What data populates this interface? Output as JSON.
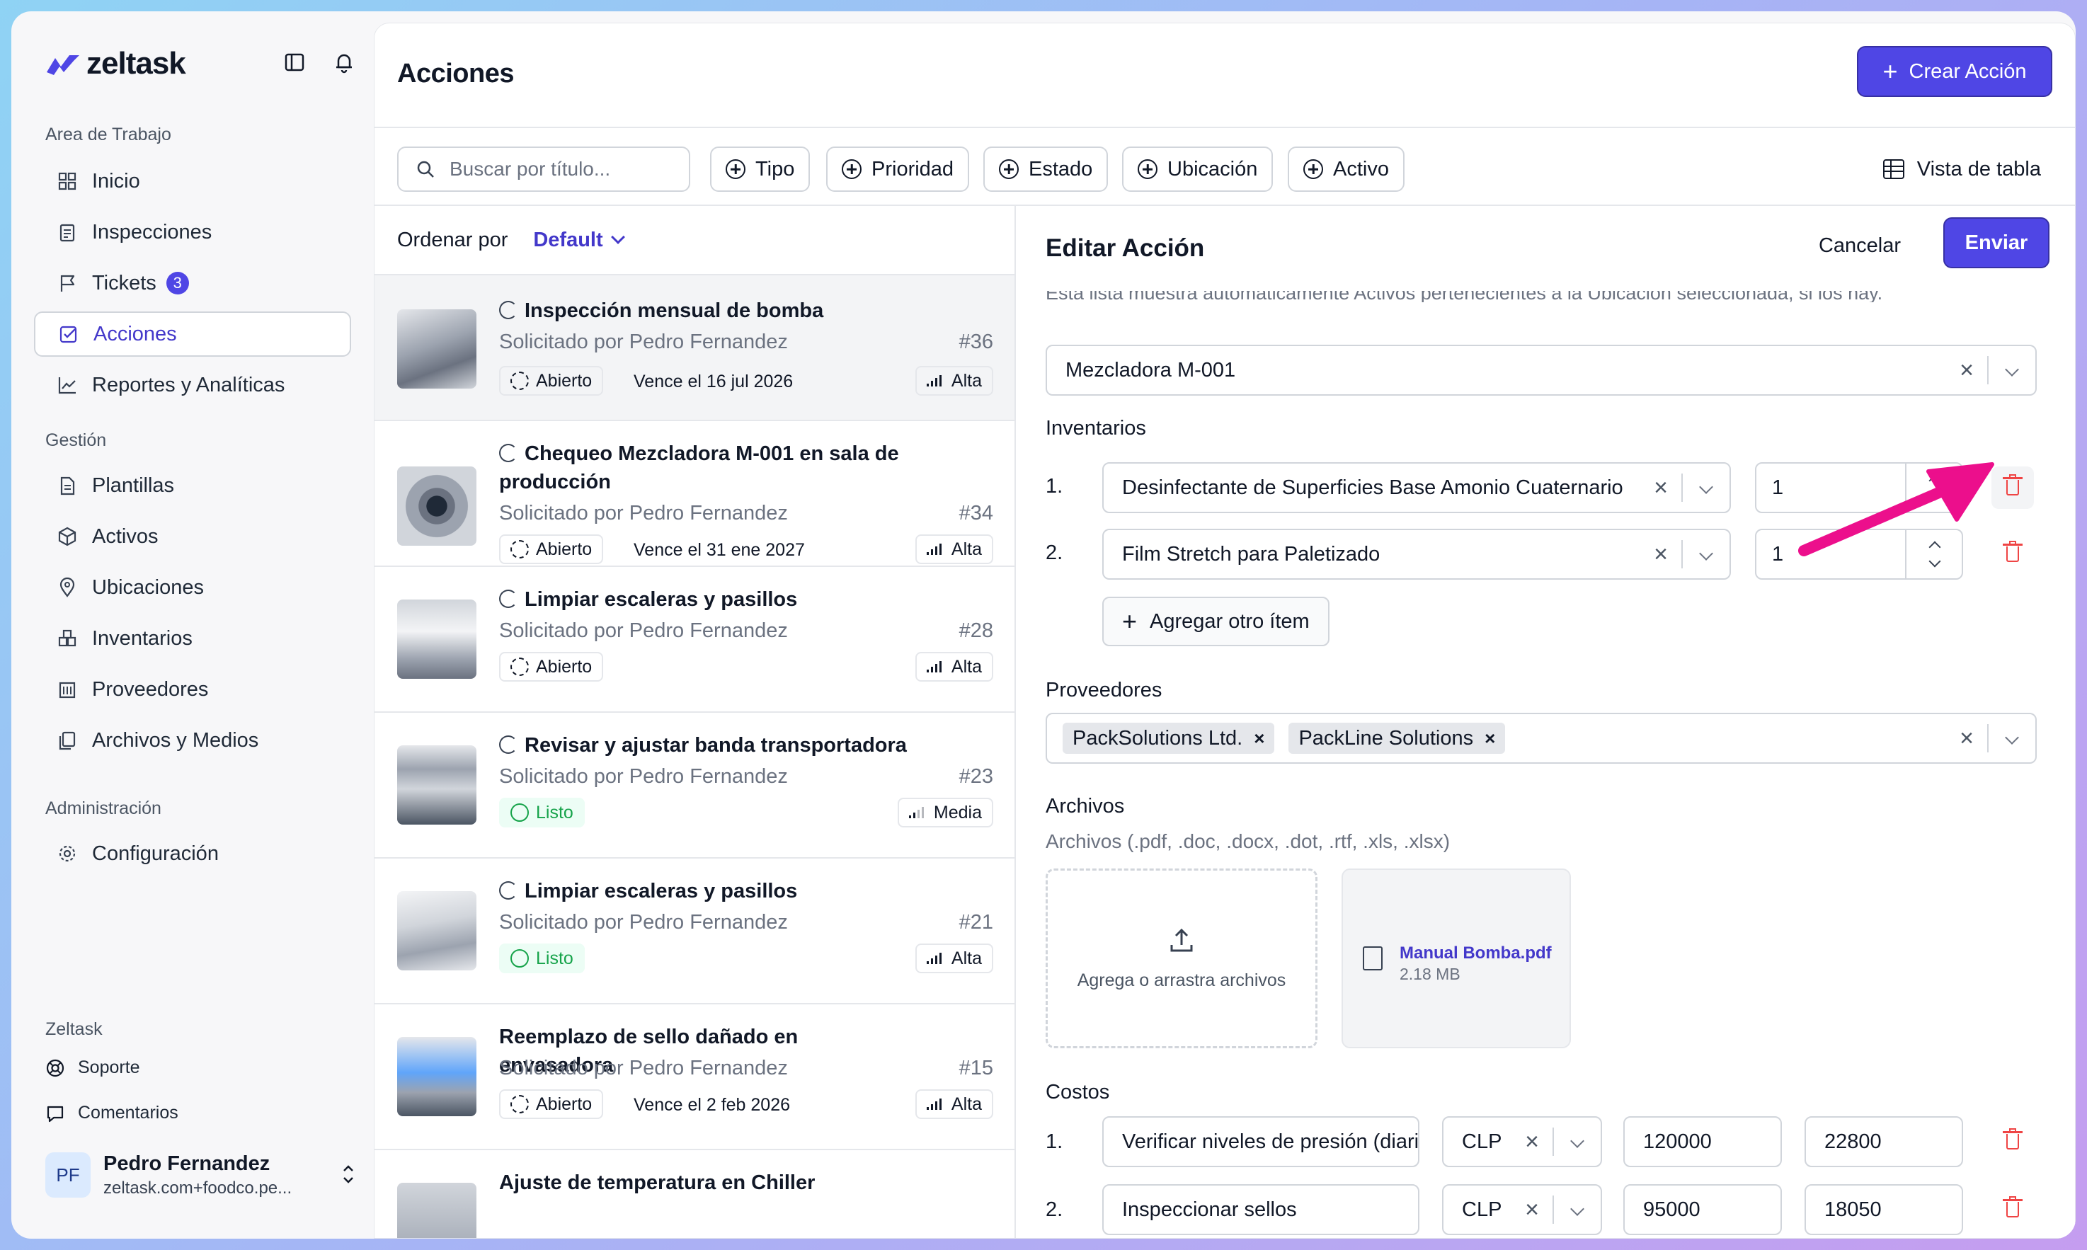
{
  "brand": {
    "name": "zeltask",
    "color": "#4f46e5"
  },
  "sidebar": {
    "workspace_label": "Area de Trabajo",
    "workspace": [
      {
        "label": "Inicio",
        "icon": "grid-icon"
      },
      {
        "label": "Inspecciones",
        "icon": "clipboard-icon"
      },
      {
        "label": "Tickets",
        "icon": "flag-icon",
        "badge": "3"
      },
      {
        "label": "Acciones",
        "icon": "check-square-icon",
        "active": true
      },
      {
        "label": "Reportes y Analíticas",
        "icon": "chart-line-icon"
      }
    ],
    "management_label": "Gestión",
    "management": [
      {
        "label": "Plantillas",
        "icon": "document-icon"
      },
      {
        "label": "Activos",
        "icon": "cube-icon"
      },
      {
        "label": "Ubicaciones",
        "icon": "map-pin-icon"
      },
      {
        "label": "Inventarios",
        "icon": "boxes-icon"
      },
      {
        "label": "Proveedores",
        "icon": "building-icon"
      },
      {
        "label": "Archivos y Medios",
        "icon": "files-icon"
      }
    ],
    "admin_label": "Administración",
    "admin": [
      {
        "label": "Configuración",
        "icon": "gear-icon"
      }
    ],
    "footer_label": "Zeltask",
    "footer": [
      {
        "label": "Soporte",
        "icon": "lifebuoy-icon"
      },
      {
        "label": "Comentarios",
        "icon": "feedback-icon"
      }
    ],
    "user": {
      "initials": "PF",
      "name": "Pedro Fernandez",
      "email": "zeltask.com+foodco.pe..."
    }
  },
  "header": {
    "title": "Acciones",
    "create_label": "Crear Acción"
  },
  "filters": {
    "search_placeholder": "Buscar por título...",
    "chips": [
      "Tipo",
      "Prioridad",
      "Estado",
      "Ubicación",
      "Activo"
    ],
    "table_view_label": "Vista de tabla"
  },
  "list": {
    "sort_label": "Ordenar por",
    "sort_value": "Default",
    "items": [
      {
        "title": "Inspección mensual de bomba",
        "recurring": true,
        "requested": "Solicitado por Pedro Fernandez",
        "number": "#36",
        "status": "Abierto",
        "due": "Vence el 16 jul 2026",
        "priority": "Alta"
      },
      {
        "title": "Chequeo Mezcladora M-001 en sala de producción",
        "recurring": true,
        "requested": "Solicitado por Pedro Fernandez",
        "number": "#34",
        "status": "Abierto",
        "due": "Vence el 31 ene 2027",
        "priority": "Alta"
      },
      {
        "title": "Limpiar escaleras y pasillos",
        "recurring": true,
        "requested": "Solicitado por Pedro Fernandez",
        "number": "#28",
        "status": "Abierto",
        "due": "",
        "priority": "Alta"
      },
      {
        "title": "Revisar y ajustar banda transportadora",
        "recurring": true,
        "requested": "Solicitado por Pedro Fernandez",
        "number": "#23",
        "status": "Listo",
        "due": "",
        "priority": "Media"
      },
      {
        "title": "Limpiar escaleras y pasillos",
        "recurring": true,
        "requested": "Solicitado por Pedro Fernandez",
        "number": "#21",
        "status": "Listo",
        "due": "",
        "priority": "Alta"
      },
      {
        "title": "Reemplazo de sello dañado en envasadora",
        "recurring": false,
        "requested": "Solicitado por Pedro Fernandez",
        "number": "#15",
        "status": "Abierto",
        "due": "Vence el 2 feb 2026",
        "priority": "Alta"
      },
      {
        "title": "Ajuste de temperatura en Chiller",
        "recurring": false
      }
    ]
  },
  "edit": {
    "title": "Editar Acción",
    "cancel_label": "Cancelar",
    "submit_label": "Enviar",
    "asset_help_cut": "Esta lista muestra automáticamente Activos pertenecientes a la Ubicación seleccionada, si los hay.",
    "asset_value": "Mezcladora M-001",
    "inventory_label": "Inventarios",
    "inventory": [
      {
        "index": "1.",
        "name": "Desinfectante de Superficies Base Amonio Cuaternario",
        "qty": "1"
      },
      {
        "index": "2.",
        "name": "Film Stretch para Paletizado",
        "qty": "1"
      }
    ],
    "add_item_label": "Agregar otro ítem",
    "suppliers_label": "Proveedores",
    "suppliers": [
      "PackSolutions Ltd.",
      "PackLine Solutions"
    ],
    "files_label": "Archivos",
    "files_help": "Archivos (.pdf, .doc, .docx, .dot, .rtf, .xls, .xlsx)",
    "dropzone_label": "Agrega o arrastra archivos",
    "file": {
      "name": "Manual Bomba.pdf",
      "size": "2.18 MB"
    },
    "costs_label": "Costos",
    "costs": [
      {
        "index": "1.",
        "desc": "Verificar niveles de presión (diario)",
        "currency": "CLP",
        "amount": "120000",
        "tax": "22800"
      },
      {
        "index": "2.",
        "desc": "Inspeccionar sellos",
        "currency": "CLP",
        "amount": "95000",
        "tax": "18050"
      }
    ]
  },
  "annotation": {
    "arrow_color": "#ec0f8c"
  }
}
